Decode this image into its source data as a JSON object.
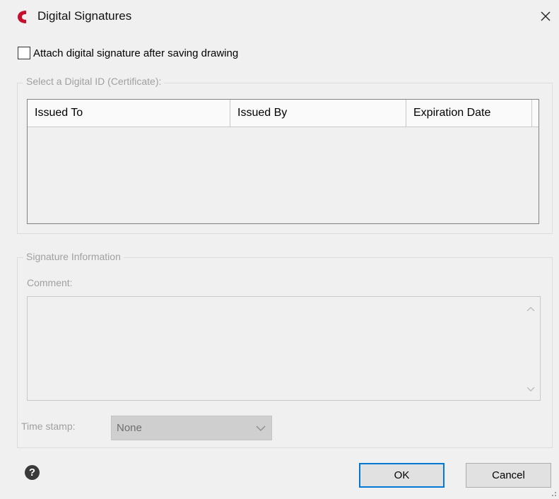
{
  "window": {
    "title": "Digital Signatures",
    "close_icon": "close-icon",
    "app_icon": "app-logo-icon",
    "brand_color": "#c8102e"
  },
  "attach": {
    "label": "Attach digital signature after saving drawing",
    "checked": false
  },
  "certificate": {
    "group_label": "Select a Digital ID (Certificate):",
    "columns": [
      "Issued To",
      "Issued By",
      "Expiration Date"
    ],
    "rows": []
  },
  "signature": {
    "group_label": "Signature Information",
    "comment_label": "Comment:",
    "comment_value": "",
    "timestamp_label": "Time stamp:",
    "timestamp_value": "None"
  },
  "footer": {
    "help_icon": "help-icon",
    "ok_label": "OK",
    "cancel_label": "Cancel",
    "accent_color": "#0078d7"
  }
}
